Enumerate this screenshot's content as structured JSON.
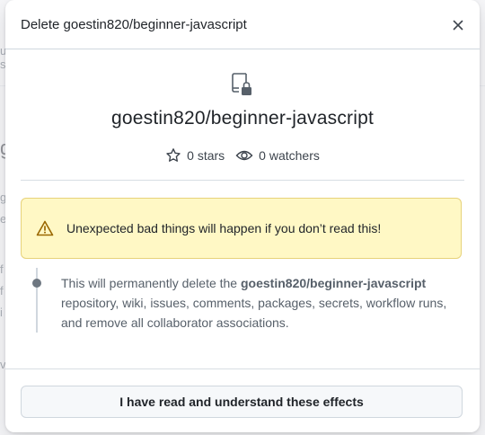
{
  "modal": {
    "title": "Delete goestin820/beginner-javascript",
    "close_icon": "x-icon"
  },
  "repo": {
    "icon": "repo-locked-icon",
    "name": "goestin820/beginner-javascript",
    "stars": "0 stars",
    "watchers": "0 watchers"
  },
  "warning": {
    "icon": "alert-icon",
    "text": "Unexpected bad things will happen if you don’t read this!"
  },
  "consequence": {
    "prefix": "This will permanently delete the ",
    "repo_name": "goestin820/beginner-javascript",
    "suffix": " repository, wiki, issues, comments, packages, secrets, workflow runs, and remove all collaborator associations."
  },
  "footer": {
    "confirm_label": "I have read and understand these effects"
  },
  "background": {
    "fragments": [
      "u",
      "s",
      "g",
      "g",
      "e",
      "f",
      "f",
      "i",
      "v",
      "il"
    ]
  },
  "colors": {
    "warning_bg": "#fff8c5",
    "warning_border": "#e7d27a",
    "warning_icon": "#9a6700"
  }
}
